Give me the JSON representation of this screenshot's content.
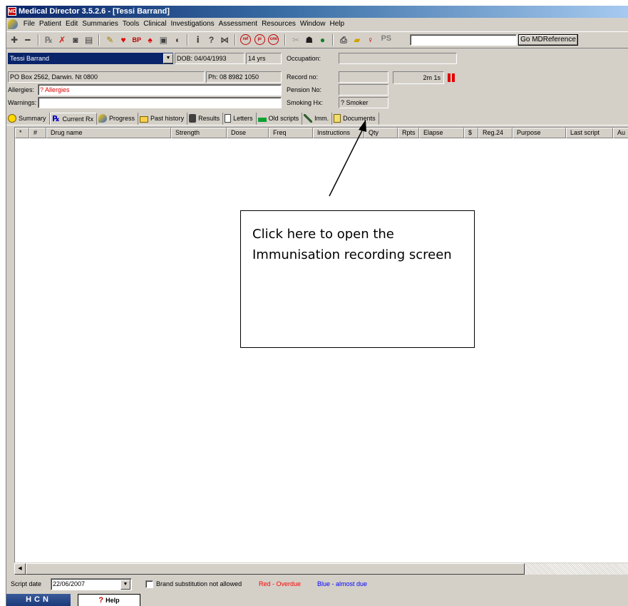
{
  "window": {
    "title": "Medical Director 3.5.2.6 - [Tessi Barrand]",
    "app_icon": "MD"
  },
  "menu": [
    "File",
    "Patient",
    "Edit",
    "Summaries",
    "Tools",
    "Clinical",
    "Investigations",
    "Assessment",
    "Resources",
    "Window",
    "Help"
  ],
  "toolbar": {
    "icons": [
      "add-icon",
      "remove-icon",
      "prescription-icon",
      "tools-icon",
      "camera-icon",
      "book-icon",
      "pen-icon",
      "heart-icon",
      "blood-pressure-icon",
      "lungs-icon",
      "clipboard-icon",
      "hearing-icon",
      "info-icon",
      "help-icon",
      "network-icon",
      "ref-icon",
      "pi-icon",
      "cmi-icon",
      "pills-icon",
      "graduate-icon",
      "apple-icon",
      "print-icon",
      "folder-open-icon",
      "person-icon"
    ],
    "ref_label": "ref",
    "pi_label": "pi",
    "cmi_label": "cmi",
    "ps_label": "PS",
    "mdref_value": "",
    "mdref_button": "Go MDReference"
  },
  "patient": {
    "name": "Tessi Barrand",
    "dob": "DOB: 04/04/1993",
    "age": "14 yrs",
    "occupation_label": "Occupation:",
    "occupation": "",
    "address": "PO Box 2562, Darwin. Nt 0800",
    "phone": "Ph: 08 8982 1050",
    "record_label": "Record no:",
    "record": "",
    "timer": "2m 1s",
    "allergies_label": "Allergies:",
    "allergies": "? Allergies",
    "pension_label": "Pension No:",
    "pension": "",
    "warnings_label": "Warnings:",
    "warnings": "",
    "smoking_label": "Smoking Hx:",
    "smoking": "? Smoker"
  },
  "tabs": [
    {
      "label": "Summary",
      "icon": "smiley-icon"
    },
    {
      "label": "Current Rx",
      "icon": "rx-icon"
    },
    {
      "label": "Progress",
      "icon": "progress-icon"
    },
    {
      "label": "Past history",
      "icon": "folder-icon"
    },
    {
      "label": "Results",
      "icon": "results-icon"
    },
    {
      "label": "Letters",
      "icon": "letters-icon"
    },
    {
      "label": "Old scripts",
      "icon": "old-scripts-icon"
    },
    {
      "label": "Imm.",
      "icon": "syringe-icon"
    },
    {
      "label": "Documents",
      "icon": "documents-icon"
    }
  ],
  "active_tab": "Current Rx",
  "grid": {
    "columns": [
      "*",
      "#",
      "Drug name",
      "Strength",
      "Dose",
      "Freq",
      "Instructions",
      "Qty",
      "Rpts",
      "Elapse",
      "$",
      "Reg.24",
      "Purpose",
      "Last script",
      "Au"
    ]
  },
  "bottom": {
    "script_date_label": "Script date",
    "script_date": "22/06/2007",
    "brand_label": "Brand substitution not allowed",
    "legend_red": "Red - Overdue",
    "legend_blue": "Blue - almost due",
    "color_red": "#ff0000",
    "color_blue": "#0000ff"
  },
  "status": {
    "hcn": "HCN",
    "help_q": "?",
    "help": "Help"
  },
  "callout": {
    "text": "Click here to open the Immunisation recording screen"
  }
}
